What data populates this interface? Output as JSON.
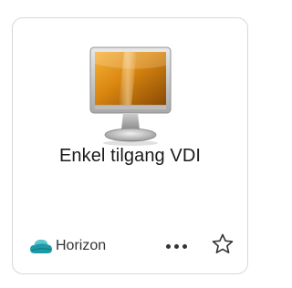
{
  "app_card": {
    "title": "Enkel tilgang VDI",
    "icon": "desktop-monitor-icon",
    "provider": {
      "label": "Horizon",
      "icon": "horizon-cloud-icon"
    },
    "actions": {
      "more_icon": "more-options-icon",
      "favorite_icon": "star-outline-icon"
    }
  },
  "colors": {
    "card_border": "#d8d8d8",
    "title_text": "#1a1a1a",
    "provider_accent": "#1c9aa6",
    "icon_gray": "#333333"
  }
}
